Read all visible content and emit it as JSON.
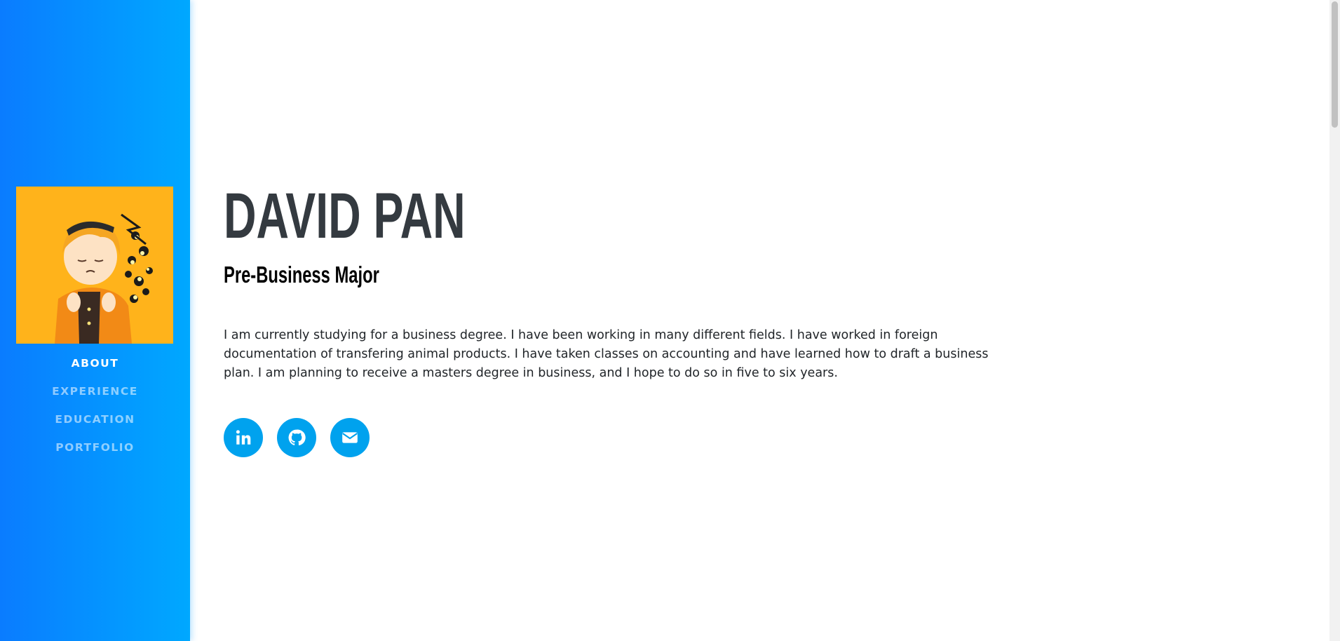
{
  "sidebar": {
    "avatar_alt": "profile avatar",
    "nav": [
      {
        "label": "ABOUT",
        "active": true
      },
      {
        "label": "EXPERIENCE",
        "active": false
      },
      {
        "label": "EDUCATION",
        "active": false
      },
      {
        "label": "PORTFOLIO",
        "active": false
      }
    ]
  },
  "about": {
    "name": "DAVID PAN",
    "subtitle": "Pre-Business Major",
    "lead": "I am currently studying for a business degree. I have been working in many different fields. I have worked in foreign documentation of transfering animal products. I have taken classes on accounting and have learned how to draft a business plan. I am planning to receive a masters degree in business, and I hope to do so in five to six years."
  },
  "socials": [
    {
      "icon": "linkedin-icon"
    },
    {
      "icon": "github-icon"
    },
    {
      "icon": "envelope-icon"
    }
  ],
  "colors": {
    "sidebar_gradient_start": "#0a7cff",
    "sidebar_gradient_end": "#00a8ff",
    "avatar_bg": "#ffb31b",
    "heading": "#343a40",
    "social_button": "#00a2ee"
  }
}
